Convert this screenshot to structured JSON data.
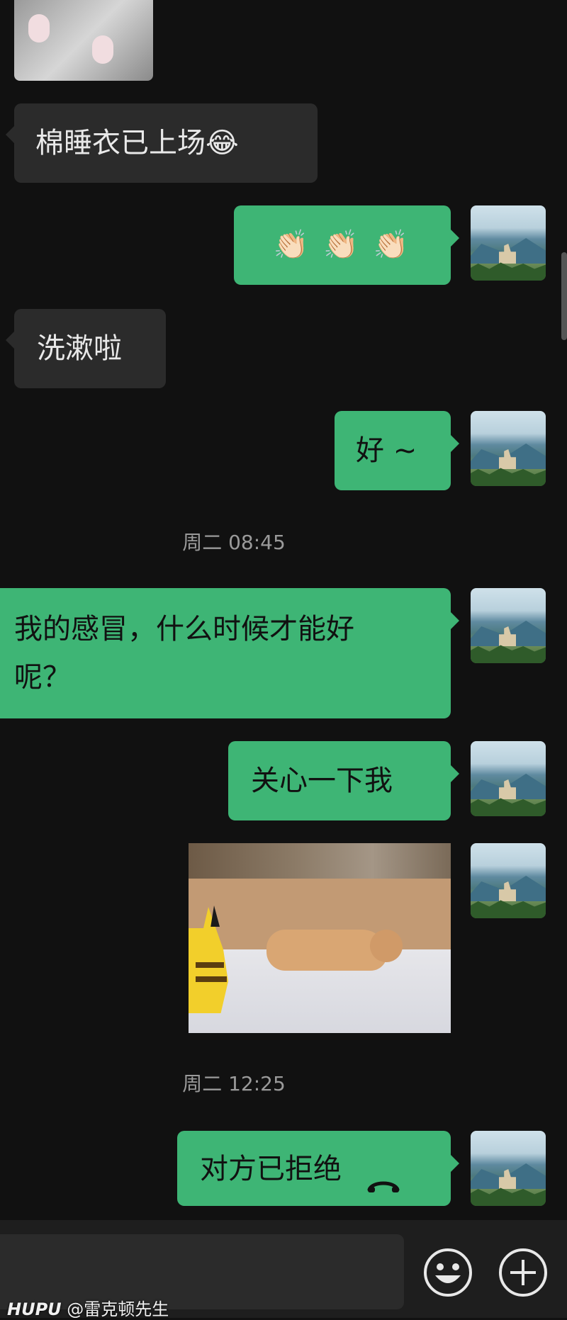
{
  "messages": {
    "m1": {
      "text": "棉睡衣已上场",
      "emoji": "😂"
    },
    "m2": {
      "emojis": "👏🏻 👏🏻 👏🏻"
    },
    "m3": {
      "text": "洗漱啦"
    },
    "m4": {
      "text": "好 ~"
    },
    "m5": {
      "text_line1": "我的感冒，什么时候才能好",
      "text_line2": "呢？"
    },
    "m6": {
      "text": "关心一下我"
    },
    "m7": {
      "image": "pikachu-cat-gif"
    },
    "m8": {
      "text": "对方已拒绝",
      "icon": "phone-hangup-icon"
    }
  },
  "timestamps": {
    "t1": "周二 08:45",
    "t2": "周二 12:25"
  },
  "watermark": {
    "brand": "HUPU",
    "user": "@雷克顿先生"
  },
  "colors": {
    "incoming_bubble": "#2b2b2b",
    "outgoing_bubble": "#3eb575",
    "background": "#111111"
  }
}
